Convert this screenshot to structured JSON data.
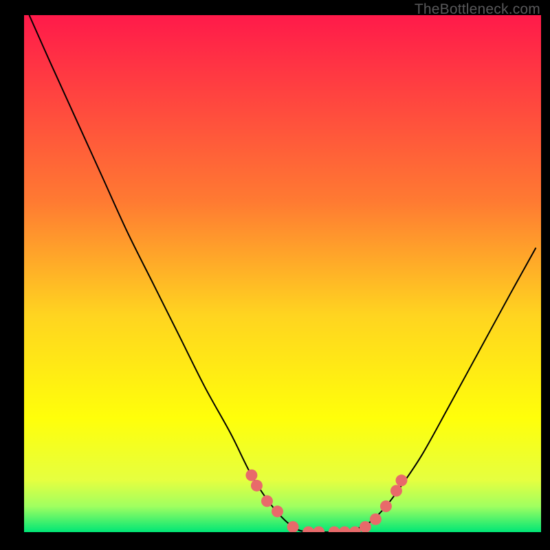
{
  "attribution": "TheBottleneck.com",
  "chart_data": {
    "type": "line",
    "title": "",
    "xlabel": "",
    "ylabel": "",
    "xlim": [
      0,
      100
    ],
    "ylim": [
      0,
      100
    ],
    "series": [
      {
        "name": "bottleneck-curve",
        "x": [
          1,
          5,
          10,
          15,
          20,
          25,
          30,
          35,
          40,
          44,
          48,
          52,
          55,
          58,
          60,
          62,
          64,
          67,
          70,
          73,
          77,
          82,
          88,
          94,
          99
        ],
        "y": [
          100,
          91,
          80,
          69,
          58,
          48,
          38,
          28,
          19,
          11,
          5,
          1,
          0,
          0,
          0,
          0,
          0.5,
          2,
          5,
          9,
          15,
          24,
          35,
          46,
          55
        ]
      }
    ],
    "points": {
      "name": "highlight-points",
      "x": [
        44,
        45,
        47,
        49,
        52,
        55,
        57,
        60,
        62,
        64,
        66,
        68,
        70,
        72,
        73
      ],
      "y": [
        11,
        9,
        6,
        4,
        1,
        0,
        0,
        0,
        0,
        0,
        1,
        2.5,
        5,
        8,
        10
      ]
    },
    "background": {
      "gradient": [
        {
          "pct": 0,
          "color": "#ff1a4a"
        },
        {
          "pct": 36,
          "color": "#ff7a32"
        },
        {
          "pct": 58,
          "color": "#ffd420"
        },
        {
          "pct": 78,
          "color": "#ffff0a"
        },
        {
          "pct": 90,
          "color": "#e5ff40"
        },
        {
          "pct": 95,
          "color": "#a0ff60"
        },
        {
          "pct": 100,
          "color": "#00e676"
        }
      ]
    },
    "point_color": "#e86a6a",
    "curve_color": "#000000"
  }
}
